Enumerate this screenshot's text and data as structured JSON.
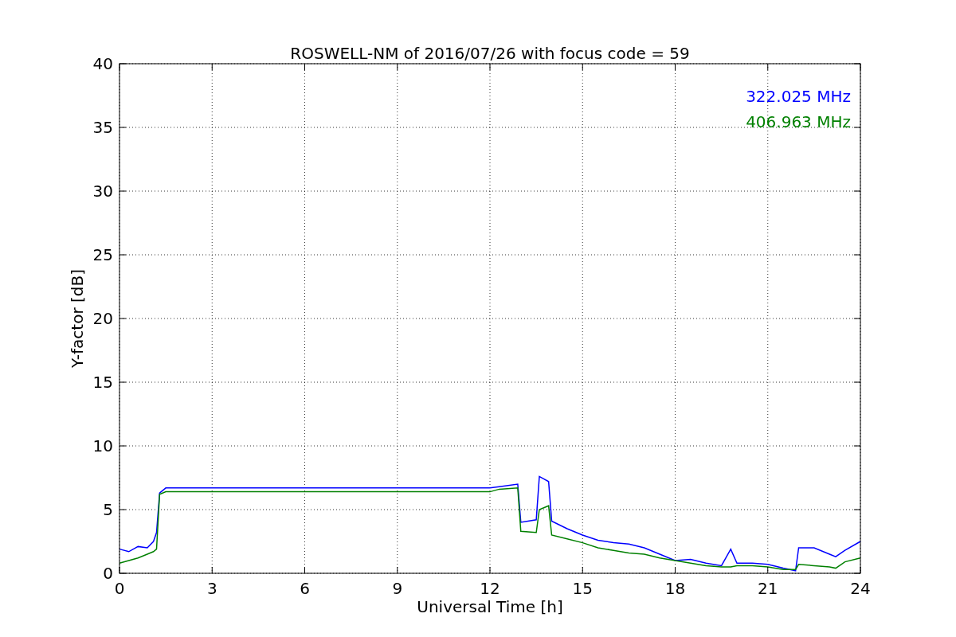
{
  "chart_data": {
    "type": "line",
    "title": "ROSWELL-NM of 2016/07/26 with focus code = 59",
    "xlabel": "Universal Time [h]",
    "ylabel": "Y-factor [dB]",
    "x": [
      0,
      0.3,
      0.6,
      0.9,
      1.1,
      1.2,
      1.3,
      1.5,
      3,
      6,
      9,
      12,
      12.3,
      12.9,
      13.0,
      13.5,
      13.6,
      13.9,
      14.0,
      14.5,
      15,
      15.5,
      16,
      16.5,
      17,
      17.5,
      18,
      18.5,
      19,
      19.5,
      19.8,
      20,
      20.5,
      21,
      21.5,
      21.9,
      22,
      22.5,
      23,
      23.2,
      23.5,
      24
    ],
    "series": [
      {
        "name": "322.025 MHz",
        "color": "#0000ff",
        "values": [
          1.9,
          1.7,
          2.1,
          2.0,
          2.5,
          3.2,
          6.3,
          6.7,
          6.7,
          6.7,
          6.7,
          6.7,
          6.8,
          7.0,
          4.0,
          4.2,
          7.6,
          7.2,
          4.1,
          3.5,
          3.0,
          2.6,
          2.4,
          2.3,
          2.0,
          1.5,
          1.0,
          1.1,
          0.8,
          0.6,
          1.9,
          0.8,
          0.8,
          0.7,
          0.4,
          0.2,
          2.0,
          2.0,
          1.5,
          1.3,
          1.8,
          2.5
        ]
      },
      {
        "name": "406.963 MHz",
        "color": "#008000",
        "values": [
          0.8,
          1.0,
          1.2,
          1.5,
          1.7,
          1.9,
          6.2,
          6.4,
          6.4,
          6.4,
          6.4,
          6.4,
          6.6,
          6.7,
          3.3,
          3.2,
          5.0,
          5.3,
          3.0,
          2.7,
          2.4,
          2.0,
          1.8,
          1.6,
          1.5,
          1.2,
          1.0,
          0.8,
          0.6,
          0.5,
          0.5,
          0.6,
          0.6,
          0.5,
          0.3,
          0.3,
          0.7,
          0.6,
          0.5,
          0.4,
          0.9,
          1.2
        ]
      }
    ],
    "xlim": [
      0,
      24
    ],
    "ylim": [
      0,
      40
    ],
    "xticks": [
      0,
      3,
      6,
      9,
      12,
      15,
      18,
      21,
      24
    ],
    "yticks": [
      0,
      5,
      10,
      15,
      20,
      25,
      30,
      35,
      40
    ],
    "grid": true
  }
}
